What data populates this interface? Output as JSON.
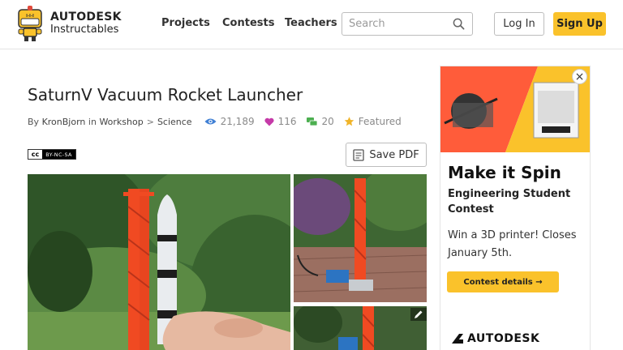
{
  "header": {
    "brand_line1": "AUTODESK",
    "brand_line2": "Instructables",
    "nav": [
      "Projects",
      "Contests",
      "Teachers"
    ],
    "search_placeholder": "Search",
    "login_label": "Log In",
    "signup_label": "Sign Up",
    "accent_color": "#fac22b"
  },
  "article": {
    "title": "SaturnV Vacuum Rocket Launcher",
    "by_prefix": "By",
    "author": "KronBjorn",
    "in_word": "in",
    "category": "Workshop",
    "breadcrumb_sep": ">",
    "subcategory": "Science",
    "views": "21,189",
    "favorites": "116",
    "comments": "20",
    "featured_label": "Featured",
    "license": {
      "cc": "cc",
      "terms": "BY-NC-SA"
    },
    "save_pdf_label": "Save PDF"
  },
  "ad": {
    "close_symbol": "×",
    "headline": "Make it Spin",
    "subhead": "Engineering Student Contest",
    "body": "Win a 3D printer! Closes January 5th.",
    "button_label": "Contest details →",
    "sponsor": "AUTODESK"
  }
}
